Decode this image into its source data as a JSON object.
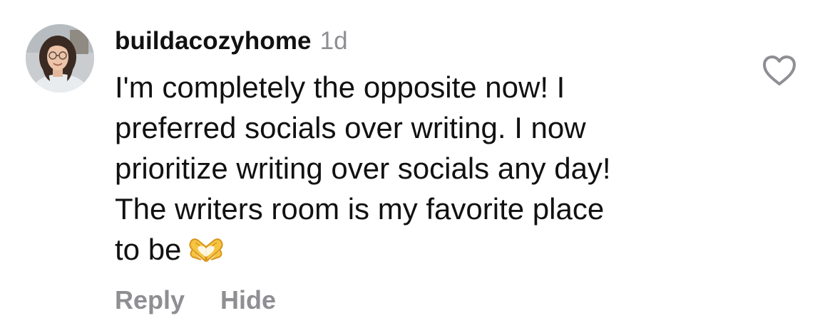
{
  "comment": {
    "username": "buildacozyhome",
    "time": "1d",
    "text": "I'm completely the opposite now! I\npreferred socials over writing. I now\nprioritize writing over socials any day!\nThe writers room is my favorite place\nto be",
    "emoji": "heart-hands-icon",
    "actions": {
      "reply": "Reply",
      "hide": "Hide"
    },
    "like_icon": "heart-outline-icon"
  },
  "colors": {
    "text": "#111111",
    "secondary": "#8e8e93",
    "background": "#ffffff"
  }
}
